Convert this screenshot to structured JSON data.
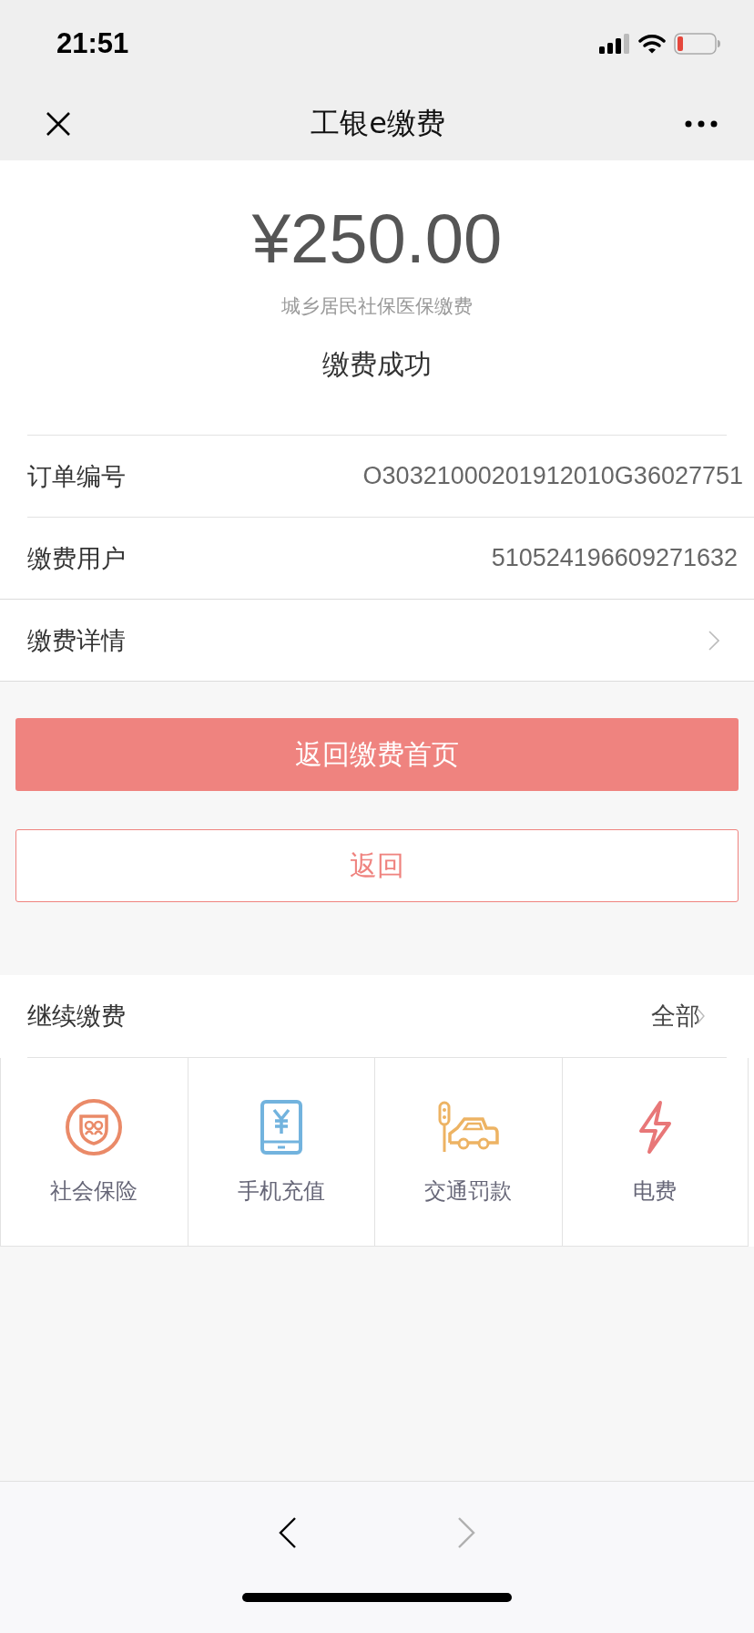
{
  "status_bar": {
    "time": "21:51"
  },
  "nav_bar": {
    "title": "工银e缴费"
  },
  "payment": {
    "amount": "¥250.00",
    "item": "城乡居民社保医保缴费",
    "status": "缴费成功"
  },
  "details": [
    {
      "label": "订单编号",
      "value": "O30321000201912010G36027751",
      "kind": "info"
    },
    {
      "label": "缴费用户",
      "value": "510524196609271632",
      "kind": "info"
    },
    {
      "label": "缴费详情",
      "kind": "link"
    }
  ],
  "buttons": [
    {
      "label": "返回缴费首页",
      "kind": "primary"
    },
    {
      "label": "返回",
      "kind": "outline"
    }
  ],
  "continue": {
    "title": "继续缴费",
    "all_link": "全部",
    "services": [
      {
        "label": "社会保险",
        "kind": "insurance"
      },
      {
        "label": "手机充值",
        "kind": "phone"
      },
      {
        "label": "交通罚款",
        "kind": "traffic"
      },
      {
        "label": "电费",
        "kind": "electric"
      }
    ]
  },
  "browser_nav": {
    "back_disabled": false,
    "forward_disabled": true
  }
}
